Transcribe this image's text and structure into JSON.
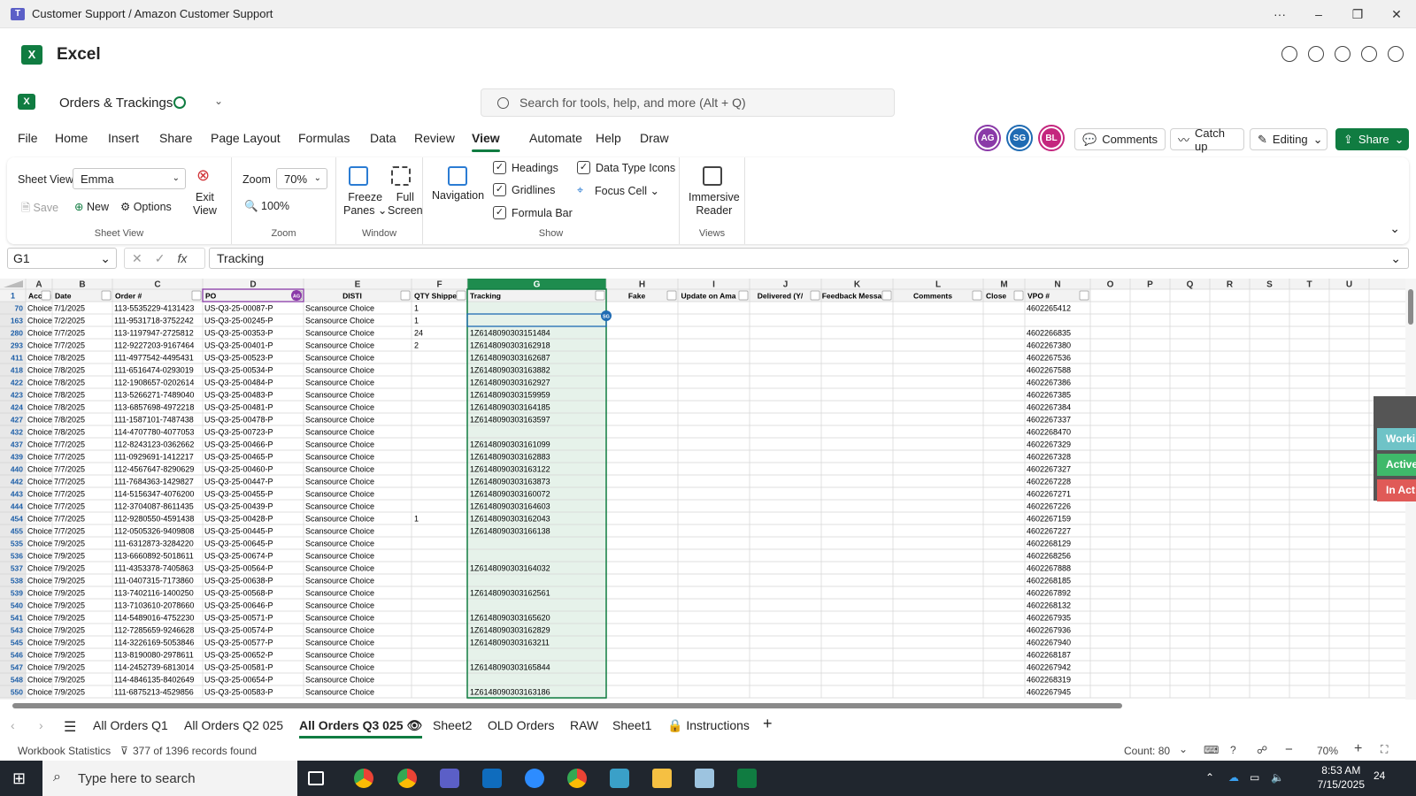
{
  "window": {
    "title": "Customer Support / Amazon Customer Support",
    "more": "···",
    "minimize": "–",
    "restore": "❐",
    "close": "✕"
  },
  "app": {
    "name": "Excel",
    "logo": "X"
  },
  "doc": {
    "name": "Orders & Trackings",
    "chev": "⌄"
  },
  "search": {
    "placeholder": "Search for tools, help, and more (Alt + Q)"
  },
  "menu": [
    "File",
    "Home",
    "Insert",
    "Share",
    "Page Layout",
    "Formulas",
    "Data",
    "Review",
    "View",
    "Automate",
    "Help",
    "Draw"
  ],
  "avatars": [
    {
      "initials": "AG",
      "color": "#8a3aa8"
    },
    {
      "initials": "SG",
      "color": "#1f6bb3"
    },
    {
      "initials": "BL",
      "color": "#c4267e"
    }
  ],
  "header_buttons": {
    "comments": "Comments",
    "catchup": "Catch up",
    "editing": "Editing",
    "share": "Share"
  },
  "ribbon": {
    "sheet_view_label": "Sheet View",
    "sheet_view_value": "Emma",
    "save": "Save",
    "new": "New",
    "options": "Options",
    "exit_view": [
      "Exit",
      "View"
    ],
    "group_sheet_view": "Sheet View",
    "zoom_label": "Zoom",
    "zoom_value": "70%",
    "zoom_100": "100%",
    "group_zoom": "Zoom",
    "freeze": [
      "Freeze",
      "Panes ⌄"
    ],
    "full": [
      "Full",
      "Screen"
    ],
    "group_window": "Window",
    "navigation": "Navigation",
    "headings": "Headings",
    "gridlines": "Gridlines",
    "formula_bar": "Formula Bar",
    "data_type_icons": "Data Type Icons",
    "focus_cell": "Focus Cell ⌄",
    "group_show": "Show",
    "immersive": [
      "Immersive",
      "Reader"
    ],
    "group_views": "Views"
  },
  "formula_bar": {
    "name_box": "G1",
    "content": "Tracking",
    "fx": "fx"
  },
  "columns": [
    {
      "letter": "A",
      "w": 30
    },
    {
      "letter": "B",
      "w": 68
    },
    {
      "letter": "C",
      "w": 102
    },
    {
      "letter": "D",
      "w": 114
    },
    {
      "letter": "E",
      "w": 122
    },
    {
      "letter": "F",
      "w": 63
    },
    {
      "letter": "G",
      "w": 157
    },
    {
      "letter": "H",
      "w": 81
    },
    {
      "letter": "I",
      "w": 81
    },
    {
      "letter": "J",
      "w": 81
    },
    {
      "letter": "K",
      "w": 81
    },
    {
      "letter": "L",
      "w": 102
    },
    {
      "letter": "M",
      "w": 47
    },
    {
      "letter": "N",
      "w": 74
    },
    {
      "letter": "O",
      "w": 45
    },
    {
      "letter": "P",
      "w": 45
    },
    {
      "letter": "Q",
      "w": 45
    },
    {
      "letter": "R",
      "w": 45
    },
    {
      "letter": "S",
      "w": 45
    },
    {
      "letter": "T",
      "w": 45
    },
    {
      "letter": "U",
      "w": 45
    }
  ],
  "header_row": {
    "num": "1",
    "cells": [
      "Accou",
      "Date",
      "Order #",
      "PO",
      "DISTI",
      "QTY Shippe",
      "Tracking",
      "Fake",
      "Update on Ama",
      "Delivered (Y/",
      "Feedback Messa",
      "Comments",
      "Close",
      "VPO #",
      "",
      "",
      "",
      "",
      "",
      "",
      ""
    ]
  },
  "rows": [
    [
      "70",
      "Choice",
      "7/1/2025",
      "113-5535229-4131423",
      "US-Q3-25-00087-P",
      "Scansource Choice",
      "1",
      "",
      "4602265412"
    ],
    [
      "163",
      "Choice",
      "7/2/2025",
      "111-9531718-3752242",
      "US-Q3-25-00245-P",
      "Scansource Choice",
      "1",
      "",
      ""
    ],
    [
      "280",
      "Choice",
      "7/7/2025",
      "113-1197947-2725812",
      "US-Q3-25-00353-P",
      "Scansource Choice",
      "24",
      "1Z6148090303151484",
      "4602266835"
    ],
    [
      "293",
      "Choice",
      "7/7/2025",
      "112-9227203-9167464",
      "US-Q3-25-00401-P",
      "Scansource Choice",
      "2",
      "1Z6148090303162918",
      "4602267380"
    ],
    [
      "411",
      "Choice",
      "7/8/2025",
      "111-4977542-4495431",
      "US-Q3-25-00523-P",
      "Scansource Choice",
      "",
      "1Z6148090303162687",
      "4602267536"
    ],
    [
      "418",
      "Choice",
      "7/8/2025",
      "111-6516474-0293019",
      "US-Q3-25-00534-P",
      "Scansource Choice",
      "",
      "1Z6148090303163882",
      "4602267588"
    ],
    [
      "422",
      "Choice",
      "7/8/2025",
      "112-1908657-0202614",
      "US-Q3-25-00484-P",
      "Scansource Choice",
      "",
      "1Z6148090303162927",
      "4602267386"
    ],
    [
      "423",
      "Choice",
      "7/8/2025",
      "113-5266271-7489040",
      "US-Q3-25-00483-P",
      "Scansource Choice",
      "",
      "1Z6148090303159959",
      "4602267385"
    ],
    [
      "424",
      "Choice",
      "7/8/2025",
      "113-6857698-4972218",
      "US-Q3-25-00481-P",
      "Scansource Choice",
      "",
      "1Z6148090303164185",
      "4602267384"
    ],
    [
      "427",
      "Choice",
      "7/8/2025",
      "111-1587101-7487438",
      "US-Q3-25-00478-P",
      "Scansource Choice",
      "",
      "1Z6148090303163597",
      "4602267337"
    ],
    [
      "432",
      "Choice",
      "7/8/2025",
      "114-4707780-4077053",
      "US-Q3-25-00723-P",
      "Scansource Choice",
      "",
      "",
      "4602268470"
    ],
    [
      "437",
      "Choice",
      "7/7/2025",
      "112-8243123-0362662",
      "US-Q3-25-00466-P",
      "Scansource Choice",
      "",
      "1Z6148090303161099",
      "4602267329"
    ],
    [
      "439",
      "Choice",
      "7/7/2025",
      "111-0929691-1412217",
      "US-Q3-25-00465-P",
      "Scansource Choice",
      "",
      "1Z6148090303162883",
      "4602267328"
    ],
    [
      "440",
      "Choice",
      "7/7/2025",
      "112-4567647-8290629",
      "US-Q3-25-00460-P",
      "Scansource Choice",
      "",
      "1Z6148090303163122",
      "4602267327"
    ],
    [
      "442",
      "Choice",
      "7/7/2025",
      "111-7684363-1429827",
      "US-Q3-25-00447-P",
      "Scansource Choice",
      "",
      "1Z6148090303163873",
      "4602267228"
    ],
    [
      "443",
      "Choice",
      "7/7/2025",
      "114-5156347-4076200",
      "US-Q3-25-00455-P",
      "Scansource Choice",
      "",
      "1Z6148090303160072",
      "4602267271"
    ],
    [
      "444",
      "Choice",
      "7/7/2025",
      "112-3704087-8611435",
      "US-Q3-25-00439-P",
      "Scansource Choice",
      "",
      "1Z6148090303164603",
      "4602267226"
    ],
    [
      "454",
      "Choice",
      "7/7/2025",
      "112-9280550-4591438",
      "US-Q3-25-00428-P",
      "Scansource Choice",
      "1",
      "1Z6148090303162043",
      "4602267159"
    ],
    [
      "455",
      "Choice",
      "7/7/2025",
      "112-0505326-9409808",
      "US-Q3-25-00445-P",
      "Scansource Choice",
      "",
      "1Z6148090303166138",
      "4602267227"
    ],
    [
      "535",
      "Choice",
      "7/9/2025",
      "111-6312873-3284220",
      "US-Q3-25-00645-P",
      "Scansource Choice",
      "",
      "",
      "4602268129"
    ],
    [
      "536",
      "Choice",
      "7/9/2025",
      "113-6660892-5018611",
      "US-Q3-25-00674-P",
      "Scansource Choice",
      "",
      "",
      "4602268256"
    ],
    [
      "537",
      "Choice",
      "7/9/2025",
      "111-4353378-7405863",
      "US-Q3-25-00564-P",
      "Scansource Choice",
      "",
      "1Z6148090303164032",
      "4602267888"
    ],
    [
      "538",
      "Choice",
      "7/9/2025",
      "111-0407315-7173860",
      "US-Q3-25-00638-P",
      "Scansource Choice",
      "",
      "",
      "4602268185"
    ],
    [
      "539",
      "Choice",
      "7/9/2025",
      "113-7402116-1400250",
      "US-Q3-25-00568-P",
      "Scansource Choice",
      "",
      "1Z6148090303162561",
      "4602267892"
    ],
    [
      "540",
      "Choice",
      "7/9/2025",
      "113-7103610-2078660",
      "US-Q3-25-00646-P",
      "Scansource Choice",
      "",
      "",
      "4602268132"
    ],
    [
      "541",
      "Choice",
      "7/9/2025",
      "114-5489016-4752230",
      "US-Q3-25-00571-P",
      "Scansource Choice",
      "",
      "1Z6148090303165620",
      "4602267935"
    ],
    [
      "543",
      "Choice",
      "7/9/2025",
      "112-7285659-9246628",
      "US-Q3-25-00574-P",
      "Scansource Choice",
      "",
      "1Z6148090303162829",
      "4602267936"
    ],
    [
      "545",
      "Choice",
      "7/9/2025",
      "114-3226169-5053846",
      "US-Q3-25-00577-P",
      "Scansource Choice",
      "",
      "1Z6148090303163211",
      "4602267940"
    ],
    [
      "546",
      "Choice",
      "7/9/2025",
      "113-8190080-2978611",
      "US-Q3-25-00652-P",
      "Scansource Choice",
      "",
      "",
      "4602268187"
    ],
    [
      "547",
      "Choice",
      "7/9/2025",
      "114-2452739-6813014",
      "US-Q3-25-00581-P",
      "Scansource Choice",
      "",
      "1Z6148090303165844",
      "4602267942"
    ],
    [
      "548",
      "Choice",
      "7/9/2025",
      "114-4846135-8402649",
      "US-Q3-25-00654-P",
      "Scansource Choice",
      "",
      "",
      "4602268319"
    ],
    [
      "550",
      "Choice",
      "7/9/2025",
      "111-6875213-4529856",
      "US-Q3-25-00583-P",
      "Scansource Choice",
      "",
      "1Z6148090303163186",
      "4602267945"
    ]
  ],
  "cell_markers": {
    "d_avatar": "AG",
    "g_avatar": "SG"
  },
  "side_panel": [
    {
      "label": "Worki",
      "color": "#6fc3c7"
    },
    {
      "label": "Active",
      "color": "#3fb96a"
    },
    {
      "label": "In Act",
      "color": "#e05a57"
    }
  ],
  "sheet_tabs": [
    "All Orders Q1",
    "All Orders Q2 025",
    "All Orders Q3 025",
    "Sheet2",
    "OLD Orders",
    "RAW",
    "Sheet1",
    "Instructions"
  ],
  "active_sheet_index": 2,
  "add_sheet": "+",
  "status": {
    "stats": "Workbook Statistics",
    "filter": "377 of 1396 records found",
    "count": "Count: 80",
    "zoom": "70%"
  },
  "taskbar": {
    "search": "Type here to search",
    "time": "8:53 AM",
    "date": "7/15/2025",
    "notif": "24"
  },
  "icons": [
    "teams-icon",
    "excel-icon",
    "search-icon",
    "filter-icon",
    "checkbox-icon",
    "windows-start-icon"
  ]
}
